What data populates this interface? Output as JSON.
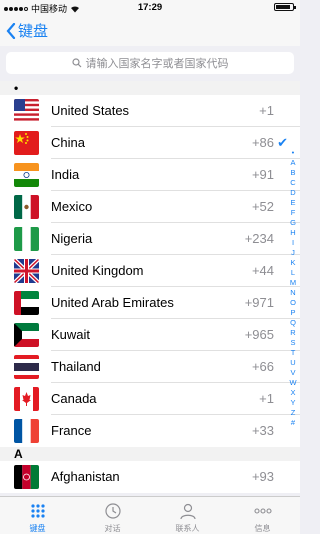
{
  "status": {
    "carrier": "中国移动",
    "time": "17:29"
  },
  "nav": {
    "back_label": "键盘"
  },
  "search": {
    "placeholder": "请输入国家名字或者国家代码"
  },
  "sections": [
    {
      "header": "•",
      "rows": [
        {
          "flag": "us-flag",
          "name": "United States",
          "code": "+1"
        },
        {
          "flag": "cn-flag",
          "name": "China",
          "code": "+86",
          "selected": true
        },
        {
          "flag": "in-flag",
          "name": "India",
          "code": "+91"
        },
        {
          "flag": "mx-flag",
          "name": "Mexico",
          "code": "+52"
        },
        {
          "flag": "ng-flag",
          "name": "Nigeria",
          "code": "+234"
        },
        {
          "flag": "gb-flag",
          "name": "United Kingdom",
          "code": "+44"
        },
        {
          "flag": "ae-flag",
          "name": "United Arab Emirates",
          "code": "+971"
        },
        {
          "flag": "kw-flag",
          "name": "Kuwait",
          "code": "+965"
        },
        {
          "flag": "th-flag",
          "name": "Thailand",
          "code": "+66"
        },
        {
          "flag": "ca-flag",
          "name": "Canada",
          "code": "+1"
        },
        {
          "flag": "fr-flag",
          "name": "France",
          "code": "+33"
        }
      ]
    },
    {
      "header": "A",
      "rows": [
        {
          "flag": "af-flag",
          "name": "Afghanistan",
          "code": "+93"
        }
      ]
    }
  ],
  "index": [
    "•",
    "A",
    "B",
    "C",
    "D",
    "E",
    "F",
    "G",
    "H",
    "I",
    "J",
    "K",
    "L",
    "M",
    "N",
    "O",
    "P",
    "Q",
    "R",
    "S",
    "T",
    "U",
    "V",
    "W",
    "X",
    "Y",
    "Z",
    "#"
  ],
  "tabs": [
    {
      "label": "键盘",
      "icon": "keypad-icon",
      "active": true
    },
    {
      "label": "对话",
      "icon": "history-icon"
    },
    {
      "label": "联系人",
      "icon": "contact-icon"
    },
    {
      "label": "信息",
      "icon": "more-icon"
    }
  ],
  "colors": {
    "accent": "#1a82f2"
  }
}
